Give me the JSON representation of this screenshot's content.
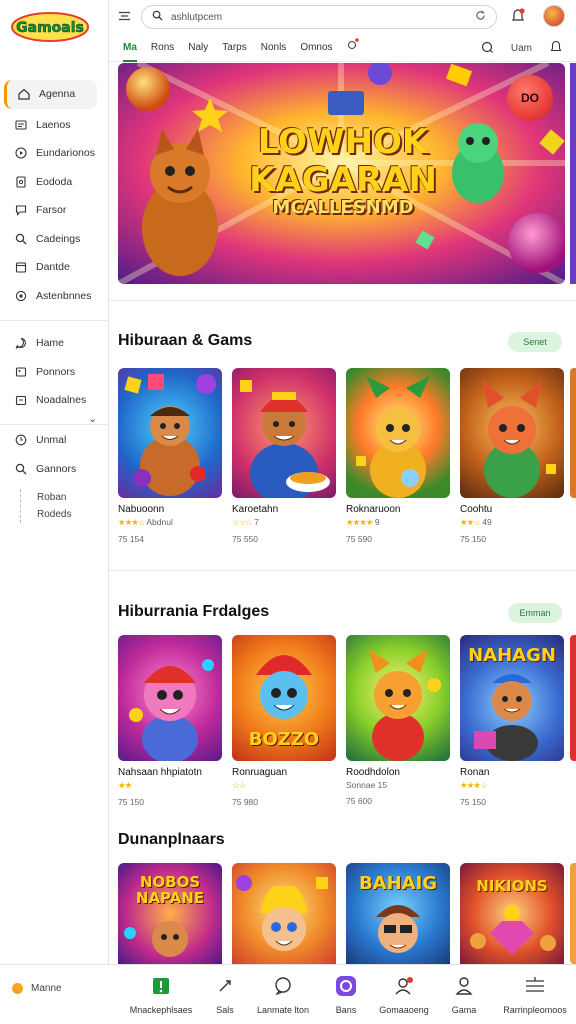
{
  "app": {
    "logo_text": "Gamoals"
  },
  "sidebar": {
    "items": [
      {
        "label": "Agenna",
        "icon": "home-icon"
      },
      {
        "label": "Laenos",
        "icon": "news-icon"
      },
      {
        "label": "Eundarionos",
        "icon": "play-icon"
      },
      {
        "label": "Eododa",
        "icon": "document-icon"
      },
      {
        "label": "Farsor",
        "icon": "chat-icon"
      },
      {
        "label": "Cadeings",
        "icon": "search-icon"
      },
      {
        "label": "Dantde",
        "icon": "calendar-icon"
      },
      {
        "label": "Astenbnnes",
        "icon": "settings-icon"
      }
    ],
    "items2": [
      {
        "label": "Hame",
        "icon": "chat-bubble-icon"
      },
      {
        "label": "Ponnors",
        "icon": "image-icon"
      },
      {
        "label": "Noadalnes",
        "icon": "folder-icon"
      }
    ],
    "items3": [
      {
        "label": "Unmal",
        "icon": "clock-icon"
      },
      {
        "label": "Gannors",
        "icon": "search-icon"
      }
    ],
    "sub_items": [
      "Roban",
      "Rodeds"
    ]
  },
  "search": {
    "value": "ashlutpcem"
  },
  "tabs": [
    "Ma",
    "Rons",
    "Naly",
    "Tarps",
    "Nonls",
    "Omnos"
  ],
  "tab_right": {
    "label": "Uam"
  },
  "hero": {
    "line1": "LOWHOK",
    "line2": "KAGARAN",
    "line3": "MCALLESNMD",
    "badge": "DO"
  },
  "sections": [
    {
      "title": "Hiburaan & Gams",
      "more": "Senet",
      "cards": [
        {
          "name": "Nabuoonn",
          "rating_text": "Abdnul",
          "meta": "75 154"
        },
        {
          "name": "Karoetahn",
          "rating_text": "7",
          "meta": "75 550"
        },
        {
          "name": "Roknaruoon",
          "rating_text": "9",
          "meta": "75 590"
        },
        {
          "name": "Coohtu",
          "rating_text": "49",
          "meta": "75 150"
        }
      ]
    },
    {
      "title": "Hiburrania Frdalges",
      "more": "Emman",
      "cards": [
        {
          "name": "Nahsaan hhpiatotn",
          "rating_text": "",
          "meta": "75 150"
        },
        {
          "name": "Ronruaguan",
          "rating_text": "",
          "meta": "75 980",
          "thumb_text": "BOZZO"
        },
        {
          "name": "Roodhdolon",
          "rating_text": "Sonnae 15",
          "meta": "75 600"
        },
        {
          "name": "Ronan",
          "rating_text": "",
          "meta": "75 150",
          "thumb_text": "NAHAGN"
        }
      ]
    },
    {
      "title": "Dunanplnaars",
      "cards": [
        {
          "thumb_text": "NOBOS NAPANE"
        },
        {
          "thumb_text": ""
        },
        {
          "thumb_text": "BAHAIG"
        },
        {
          "thumb_text": "NIKIONS"
        }
      ]
    }
  ],
  "bottom": {
    "lang": "Manne",
    "items": [
      {
        "label": "Mnackephlsaes",
        "icon": "home-filled-icon"
      },
      {
        "label": "Sals",
        "icon": "pen-icon"
      },
      {
        "label": "Lanmate lton",
        "icon": "chat-icon"
      },
      {
        "label": "Bans",
        "icon": "controller-icon"
      },
      {
        "label": "Gomaaoeng",
        "icon": "user-notify-icon"
      },
      {
        "label": "Gama",
        "icon": "user-icon"
      },
      {
        "label": "Rarrinpleomoos",
        "icon": "stack-icon"
      }
    ]
  },
  "colors": {
    "accent": "#1a8a3a",
    "pill_bg": "#dcf3df",
    "active_marker": "#f29900"
  }
}
